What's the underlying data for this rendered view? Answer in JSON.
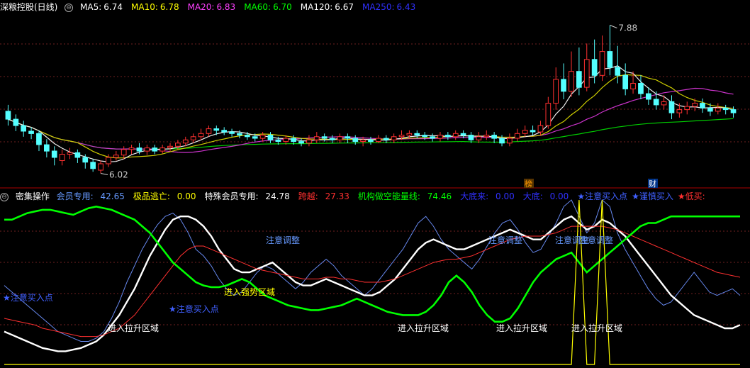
{
  "header": {
    "title": "深粮控股(日线)",
    "ma": [
      {
        "label": "MA5:",
        "value": "6.74",
        "color": "#ffffff"
      },
      {
        "label": "MA10:",
        "value": "6.78",
        "color": "#ffff00"
      },
      {
        "label": "MA20:",
        "value": "6.83",
        "color": "#ff40ff"
      },
      {
        "label": "MA60:",
        "value": "6.70",
        "color": "#00ff00"
      },
      {
        "label": "MA120:",
        "value": "6.67",
        "color": "#ffffff"
      },
      {
        "label": "MA250:",
        "value": "6.43",
        "color": "#3030ff"
      }
    ]
  },
  "indicator_header": {
    "name": "密集操作",
    "items": [
      {
        "label": "会员专用:",
        "value": "42.65",
        "color": "#6699ff"
      },
      {
        "label": "极品逃亡:",
        "value": "0.00",
        "color": "#ffff00"
      },
      {
        "label": "特殊会员专用:",
        "value": "24.78",
        "color": "#ffffff"
      },
      {
        "label": "跨越:",
        "value": "27.33",
        "color": "#ff3030"
      },
      {
        "label": "机构做空能量线:",
        "value": "74.46",
        "color": "#00ff00"
      },
      {
        "label": "大底来:",
        "value": "0.00",
        "color": "#3030ff"
      },
      {
        "label": "大底:",
        "value": "0.00",
        "color": "#3030ff"
      }
    ],
    "flags": [
      {
        "text": "★注意买入点",
        "color": "#4060ff"
      },
      {
        "text": "★谨慎买入",
        "color": "#4060ff"
      },
      {
        "text": "★低买:",
        "color": "#ff3030"
      }
    ]
  },
  "price_labels": {
    "high": "7.88",
    "low": "6.02"
  },
  "badges": [
    {
      "text": "榜",
      "color": "#ff9900",
      "bg": "#553300"
    },
    {
      "text": "财",
      "color": "#ffffff",
      "bg": "#003388"
    }
  ],
  "annotations": [
    {
      "text": "注意调整",
      "color": "#6699ff"
    },
    {
      "text": "注意调整",
      "color": "#6699ff"
    },
    {
      "text": "注意调整",
      "color": "#6699ff"
    },
    {
      "text": "注意调整",
      "color": "#6699ff"
    },
    {
      "text": "进入强势区域",
      "color": "#ffff00"
    },
    {
      "text": "进入拉升区域",
      "color": "#ffffff"
    },
    {
      "text": "进入拉升区域",
      "color": "#ffffff"
    },
    {
      "text": "进入拉升区域",
      "color": "#ffffff"
    },
    {
      "text": "进入拉升区域",
      "color": "#ffffff"
    },
    {
      "text": "★注意买入点",
      "color": "#4060ff"
    },
    {
      "text": "★注意买入点",
      "color": "#4060ff"
    }
  ],
  "chart_data": [
    {
      "type": "candlestick",
      "title": "深粮控股(日线)",
      "ylim": [
        5.9,
        8.0
      ],
      "up_color": "#ff3030",
      "down_color": "#54ffff",
      "candles": [
        [
          6.8,
          6.7,
          6.88,
          6.62
        ],
        [
          6.7,
          6.62,
          6.76,
          6.55
        ],
        [
          6.62,
          6.55,
          6.68,
          6.48
        ],
        [
          6.55,
          6.52,
          6.6,
          6.45
        ],
        [
          6.52,
          6.38,
          6.56,
          6.3
        ],
        [
          6.38,
          6.3,
          6.45,
          6.22
        ],
        [
          6.3,
          6.22,
          6.36,
          6.12
        ],
        [
          6.18,
          6.26,
          6.32,
          6.12
        ],
        [
          6.26,
          6.28,
          6.34,
          6.2
        ],
        [
          6.28,
          6.22,
          6.32,
          6.15
        ],
        [
          6.22,
          6.16,
          6.26,
          6.08
        ],
        [
          6.16,
          6.08,
          6.2,
          6.04
        ],
        [
          6.06,
          6.14,
          6.18,
          6.02
        ],
        [
          6.14,
          6.22,
          6.26,
          6.1
        ],
        [
          6.22,
          6.25,
          6.3,
          6.18
        ],
        [
          6.25,
          6.32,
          6.36,
          6.2
        ],
        [
          6.32,
          6.34,
          6.38,
          6.26
        ],
        [
          6.34,
          6.3,
          6.4,
          6.26
        ],
        [
          6.3,
          6.34,
          6.38,
          6.25
        ],
        [
          6.34,
          6.3,
          6.38,
          6.26
        ],
        [
          6.3,
          6.34,
          6.38,
          6.27
        ],
        [
          6.34,
          6.36,
          6.4,
          6.3
        ],
        [
          6.36,
          6.4,
          6.44,
          6.32
        ],
        [
          6.4,
          6.44,
          6.48,
          6.36
        ],
        [
          6.44,
          6.48,
          6.52,
          6.4
        ],
        [
          6.48,
          6.52,
          6.58,
          6.44
        ],
        [
          6.52,
          6.58,
          6.62,
          6.48
        ],
        [
          6.58,
          6.56,
          6.62,
          6.5
        ],
        [
          6.56,
          6.54,
          6.6,
          6.5
        ],
        [
          6.54,
          6.52,
          6.58,
          6.48
        ],
        [
          6.52,
          6.5,
          6.56,
          6.46
        ],
        [
          6.5,
          6.48,
          6.54,
          6.44
        ],
        [
          6.48,
          6.46,
          6.52,
          6.42
        ],
        [
          6.46,
          6.5,
          6.54,
          6.42
        ],
        [
          6.5,
          6.44,
          6.54,
          6.4
        ],
        [
          6.44,
          6.42,
          6.48,
          6.38
        ],
        [
          6.42,
          6.46,
          6.5,
          6.38
        ],
        [
          6.46,
          6.42,
          6.5,
          6.38
        ],
        [
          6.42,
          6.4,
          6.46,
          6.36
        ],
        [
          6.4,
          6.44,
          6.5,
          6.36
        ],
        [
          6.44,
          6.48,
          6.54,
          6.4
        ],
        [
          6.48,
          6.46,
          6.52,
          6.42
        ],
        [
          6.46,
          6.44,
          6.5,
          6.4
        ],
        [
          6.44,
          6.48,
          6.52,
          6.4
        ],
        [
          6.48,
          6.46,
          6.52,
          6.4
        ],
        [
          6.46,
          6.42,
          6.5,
          6.38
        ],
        [
          6.42,
          6.44,
          6.48,
          6.36
        ],
        [
          6.44,
          6.42,
          6.48,
          6.38
        ],
        [
          6.42,
          6.46,
          6.5,
          6.4
        ],
        [
          6.46,
          6.44,
          6.5,
          6.4
        ],
        [
          6.44,
          6.48,
          6.52,
          6.4
        ],
        [
          6.48,
          6.5,
          6.56,
          6.44
        ],
        [
          6.5,
          6.52,
          6.56,
          6.46
        ],
        [
          6.52,
          6.5,
          6.56,
          6.46
        ],
        [
          6.5,
          6.48,
          6.54,
          6.44
        ],
        [
          6.48,
          6.46,
          6.52,
          6.42
        ],
        [
          6.46,
          6.5,
          6.54,
          6.42
        ],
        [
          6.5,
          6.48,
          6.54,
          6.44
        ],
        [
          6.48,
          6.52,
          6.56,
          6.44
        ],
        [
          6.52,
          6.5,
          6.56,
          6.46
        ],
        [
          6.5,
          6.44,
          6.54,
          6.4
        ],
        [
          6.44,
          6.48,
          6.54,
          6.4
        ],
        [
          6.48,
          6.5,
          6.56,
          6.44
        ],
        [
          6.5,
          6.46,
          6.54,
          6.4
        ],
        [
          6.46,
          6.4,
          6.5,
          6.36
        ],
        [
          6.4,
          6.46,
          6.52,
          6.36
        ],
        [
          6.46,
          6.52,
          6.58,
          6.42
        ],
        [
          6.52,
          6.56,
          6.62,
          6.48
        ],
        [
          6.56,
          6.54,
          6.62,
          6.5
        ],
        [
          6.54,
          6.62,
          6.68,
          6.5
        ],
        [
          6.62,
          6.9,
          6.98,
          6.58
        ],
        [
          6.9,
          7.2,
          7.35,
          6.82
        ],
        [
          7.2,
          7.05,
          7.4,
          6.95
        ],
        [
          7.05,
          7.3,
          7.55,
          6.98
        ],
        [
          7.3,
          7.1,
          7.6,
          7.0
        ],
        [
          7.1,
          7.45,
          7.65,
          7.05
        ],
        [
          7.45,
          7.25,
          7.7,
          7.15
        ],
        [
          7.25,
          7.55,
          7.75,
          7.18
        ],
        [
          7.55,
          7.35,
          7.88,
          7.25
        ],
        [
          7.35,
          7.25,
          7.62,
          7.15
        ],
        [
          7.25,
          7.08,
          7.4,
          7.0
        ],
        [
          7.08,
          7.15,
          7.3,
          7.02
        ],
        [
          7.15,
          7.02,
          7.25,
          6.95
        ],
        [
          7.02,
          6.95,
          7.1,
          6.88
        ],
        [
          6.95,
          6.88,
          7.05,
          6.82
        ],
        [
          6.88,
          6.92,
          7.0,
          6.82
        ],
        [
          6.92,
          6.78,
          7.0,
          6.7
        ],
        [
          6.78,
          6.82,
          6.9,
          6.72
        ],
        [
          6.82,
          6.86,
          6.92,
          6.76
        ],
        [
          6.86,
          6.9,
          6.96,
          6.8
        ],
        [
          6.9,
          6.84,
          6.96,
          6.78
        ],
        [
          6.84,
          6.8,
          6.9,
          6.74
        ],
        [
          6.8,
          6.84,
          6.9,
          6.76
        ],
        [
          6.84,
          6.82,
          6.88,
          6.76
        ],
        [
          6.82,
          6.78,
          6.86,
          6.72
        ]
      ]
    },
    {
      "type": "line",
      "title": "密集操作",
      "ylim": [
        0,
        100
      ],
      "series": [
        {
          "name": "会员专用",
          "color": "#6688ee",
          "values": [
            48,
            44,
            40,
            36,
            32,
            28,
            24,
            20,
            18,
            16,
            14,
            14,
            16,
            20,
            28,
            38,
            50,
            60,
            70,
            78,
            85,
            90,
            92,
            88,
            80,
            70,
            66,
            60,
            52,
            46,
            42,
            44,
            50,
            56,
            60,
            58,
            54,
            50,
            46,
            50,
            56,
            60,
            64,
            60,
            54,
            50,
            46,
            42,
            46,
            52,
            58,
            64,
            70,
            78,
            86,
            90,
            84,
            76,
            70,
            66,
            62,
            58,
            64,
            72,
            80,
            86,
            88,
            82,
            74,
            68,
            70,
            78,
            86,
            96,
            100,
            90,
            80,
            86,
            100,
            96,
            80,
            70,
            62,
            54,
            46,
            40,
            36,
            38,
            44,
            50,
            56,
            50,
            44,
            42,
            44,
            46,
            42
          ]
        },
        {
          "name": "特殊会员专用",
          "color": "#ffffff",
          "values": [
            20,
            18,
            16,
            14,
            12,
            10,
            9,
            8,
            8,
            9,
            10,
            12,
            14,
            18,
            24,
            30,
            38,
            46,
            56,
            66,
            74,
            82,
            88,
            90,
            90,
            88,
            84,
            78,
            70,
            64,
            58,
            56,
            56,
            58,
            60,
            62,
            58,
            54,
            50,
            48,
            48,
            50,
            52,
            50,
            48,
            46,
            44,
            42,
            42,
            44,
            48,
            52,
            58,
            64,
            70,
            74,
            76,
            74,
            72,
            70,
            70,
            72,
            74,
            76,
            78,
            80,
            82,
            80,
            78,
            76,
            76,
            80,
            84,
            88,
            90,
            86,
            82,
            84,
            88,
            86,
            82,
            78,
            72,
            66,
            60,
            54,
            48,
            42,
            38,
            34,
            30,
            28,
            26,
            24,
            22,
            22,
            24
          ]
        },
        {
          "name": "跨越",
          "color": "#ff3030",
          "values": [
            28,
            27,
            26,
            25,
            24,
            22,
            21,
            20,
            19,
            18,
            17,
            17,
            17,
            18,
            20,
            22,
            26,
            30,
            36,
            42,
            48,
            54,
            60,
            66,
            70,
            72,
            72,
            70,
            68,
            66,
            64,
            62,
            60,
            58,
            57,
            56,
            55,
            54,
            53,
            52,
            52,
            52,
            53,
            53,
            52,
            52,
            51,
            50,
            50,
            50,
            51,
            52,
            54,
            56,
            58,
            60,
            62,
            63,
            64,
            64,
            65,
            66,
            68,
            70,
            72,
            74,
            76,
            77,
            78,
            78,
            78,
            79,
            80,
            82,
            84,
            84,
            84,
            84,
            84,
            83,
            82,
            80,
            78,
            76,
            74,
            72,
            70,
            68,
            66,
            64,
            62,
            60,
            58,
            56,
            55,
            54,
            53
          ]
        },
        {
          "name": "机构做空能量线",
          "color": "#00ff00",
          "values": [
            88,
            88,
            90,
            92,
            93,
            94,
            94,
            93,
            92,
            91,
            93,
            95,
            96,
            95,
            94,
            92,
            90,
            88,
            84,
            80,
            74,
            68,
            62,
            58,
            54,
            50,
            48,
            47,
            47,
            48,
            50,
            52,
            50,
            46,
            42,
            40,
            38,
            36,
            35,
            34,
            33,
            33,
            34,
            35,
            36,
            38,
            40,
            38,
            36,
            34,
            32,
            31,
            30,
            30,
            30,
            32,
            36,
            42,
            50,
            54,
            50,
            44,
            36,
            30,
            26,
            26,
            28,
            34,
            42,
            50,
            56,
            60,
            64,
            66,
            68,
            62,
            56,
            60,
            64,
            68,
            72,
            76,
            80,
            84,
            86,
            86,
            88,
            90,
            90,
            90,
            90,
            90,
            90,
            90,
            90,
            90,
            90
          ]
        },
        {
          "name": "极品逃亡",
          "color": "#ffff00",
          "values": [
            0,
            0,
            0,
            0,
            0,
            0,
            0,
            0,
            0,
            0,
            0,
            0,
            0,
            0,
            0,
            0,
            0,
            0,
            0,
            0,
            0,
            0,
            0,
            0,
            0,
            0,
            0,
            0,
            0,
            0,
            0,
            0,
            0,
            0,
            0,
            0,
            0,
            0,
            0,
            0,
            0,
            0,
            0,
            0,
            0,
            0,
            0,
            0,
            0,
            0,
            0,
            0,
            0,
            0,
            0,
            0,
            0,
            0,
            0,
            0,
            0,
            0,
            0,
            0,
            0,
            0,
            0,
            0,
            0,
            0,
            0,
            0,
            0,
            0,
            0,
            100,
            0,
            0,
            100,
            0,
            0,
            0,
            0,
            0,
            0,
            0,
            0,
            0,
            0,
            0,
            0,
            0,
            0,
            0,
            0,
            0,
            0
          ]
        }
      ]
    }
  ]
}
